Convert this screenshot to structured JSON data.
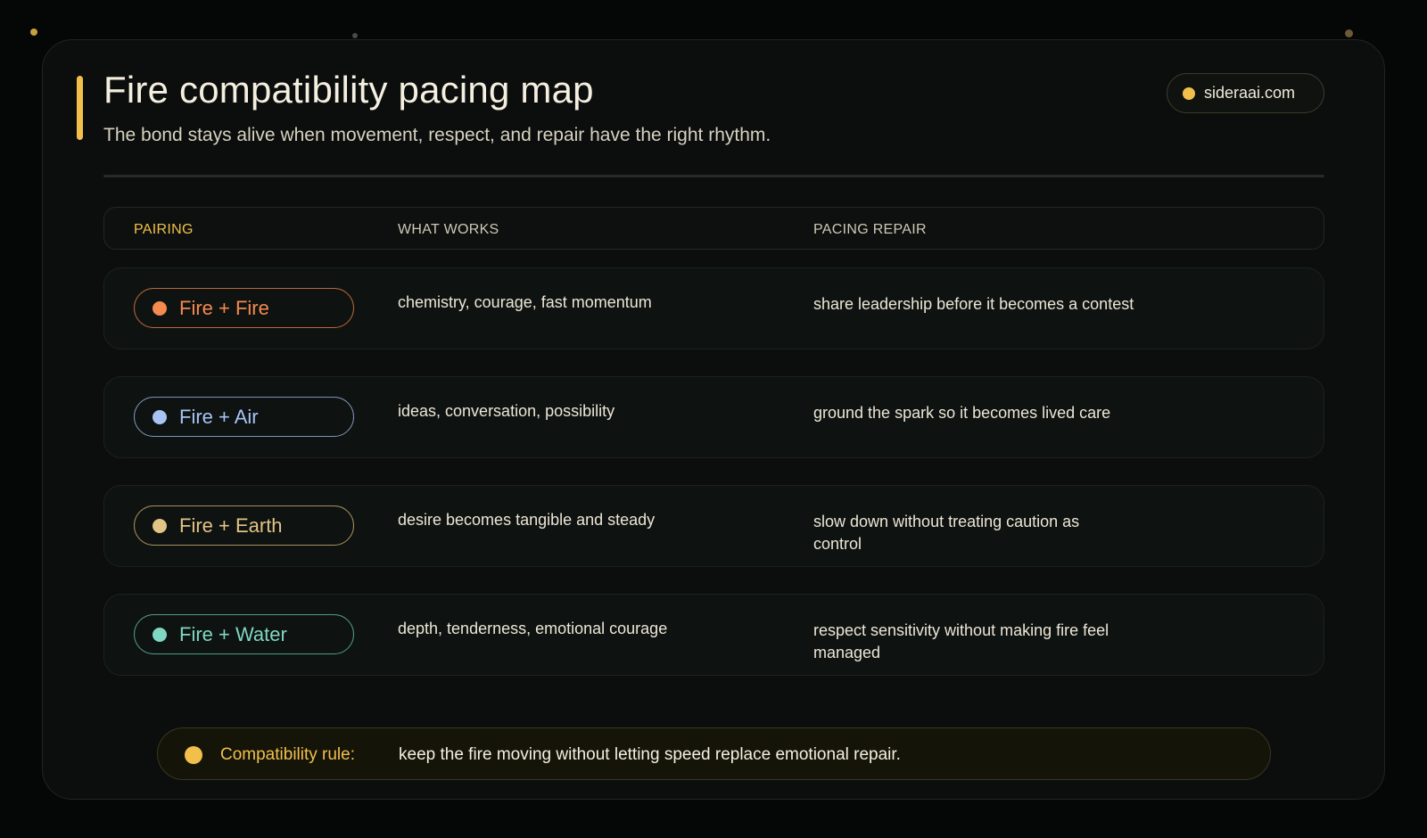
{
  "header": {
    "title": "Fire compatibility pacing map",
    "subtitle": "The bond stays alive when movement, respect, and repair have the right rhythm.",
    "site": "sideraai.com"
  },
  "table": {
    "columns": [
      "PAIRING",
      "WHAT WORKS",
      "PACING REPAIR"
    ],
    "rows": [
      {
        "pairing": "Fire + Fire",
        "works": "chemistry, courage, fast momentum",
        "repair": "share leadership before it becomes a contest",
        "color": "#f48a4f",
        "border": "#b9683a"
      },
      {
        "pairing": "Fire + Air",
        "works": "ideas, conversation, possibility",
        "repair": "ground the spark so it becomes lived care",
        "color": "#a7c4f5",
        "border": "#7f95b8"
      },
      {
        "pairing": "Fire + Earth",
        "works": "desire becomes tangible and steady",
        "repair": "slow down without treating caution as control",
        "color": "#e1c486",
        "border": "#a89160"
      },
      {
        "pairing": "Fire + Water",
        "works": "depth, tenderness, emotional courage",
        "repair": "respect sensitivity without making fire feel managed",
        "color": "#7fd7c2",
        "border": "#4f9c8c"
      }
    ]
  },
  "rule": {
    "label": "Compatibility rule:",
    "text": "keep the fire moving without letting speed replace emotional repair."
  },
  "colors": {
    "accent": "#f2c04a",
    "background": "#050707",
    "card": "#0b0e0d"
  }
}
